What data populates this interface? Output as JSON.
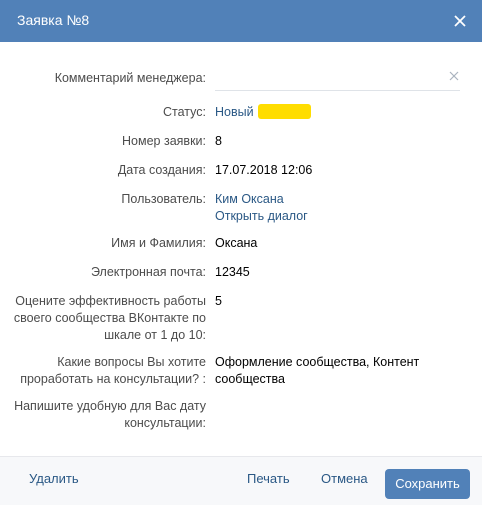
{
  "header": {
    "title": "Заявка №8"
  },
  "fields": {
    "comment_label": "Комментарий менеджера:",
    "comment_value": "",
    "status_label": "Статус:",
    "status_value": "Новый",
    "number_label": "Номер заявки:",
    "number_value": "8",
    "date_label": "Дата создания:",
    "date_value": "17.07.2018 12:06",
    "user_label": "Пользователь:",
    "user_name": "Ким Оксана",
    "user_dialog": "Открыть диалог",
    "fullname_label": "Имя и Фамилия:",
    "fullname_value": "Оксана",
    "email_label": "Электронная почта:",
    "email_value": "12345",
    "rating_label_1": "Оцените эффективность работы",
    "rating_label_2": "своего сообщества ВКонтакте по",
    "rating_label_3": "шкале от 1 до 10:",
    "rating_value": "5",
    "questions_label_1": "Какие вопросы Вы хотите",
    "questions_label_2": "проработать на консультации? :",
    "questions_value_1": "Оформление сообщества, Контент",
    "questions_value_2": "сообщества",
    "date_pref_label_1": "Напишите удобную для Вас дату",
    "date_pref_label_2": "консультации:"
  },
  "footer": {
    "delete_label": "Удалить",
    "print_label": "Печать",
    "cancel_label": "Отмена",
    "save_label": "Сохранить"
  },
  "colors": {
    "header": "#5181b8",
    "link": "#2a5885",
    "status_badge": "#ffdd00",
    "save_button": "#5181b8"
  },
  "icons": {
    "close": "close-icon",
    "clear": "clear-icon"
  }
}
